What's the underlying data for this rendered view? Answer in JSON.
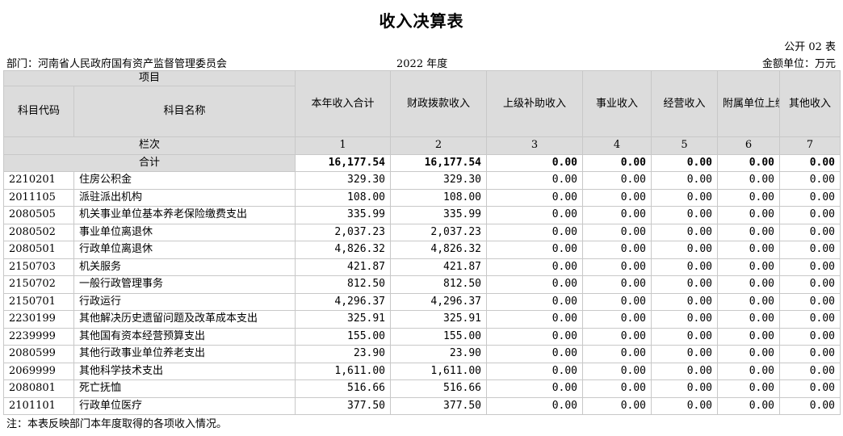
{
  "title": "收入决算表",
  "code": "公开 02 表",
  "department": "部门：河南省人民政府国有资产监督管理委员会",
  "year": "2022 年度",
  "unit": "金额单位：万元",
  "headers": {
    "item_group": "项目",
    "subject_code": "科目代码",
    "subject_name": "科目名称",
    "total_income": "本年收入合计",
    "fiscal_appropriation": "财政拨款收入",
    "superior_subsidy": "上级补助收入",
    "business_income": "事业收入",
    "operating_income": "经营收入",
    "affiliated_income": "附属单位上缴收入",
    "other_income": "其他收入",
    "column_index_label": "栏次",
    "column_numbers": [
      "1",
      "2",
      "3",
      "4",
      "5",
      "6",
      "7"
    ]
  },
  "total_row": {
    "label": "合计",
    "values": [
      "16,177.54",
      "16,177.54",
      "0.00",
      "0.00",
      "0.00",
      "0.00",
      "0.00"
    ]
  },
  "rows": [
    {
      "code": "2210201",
      "name": "住房公积金",
      "values": [
        "329.30",
        "329.30",
        "0.00",
        "0.00",
        "0.00",
        "0.00",
        "0.00"
      ]
    },
    {
      "code": "2011105",
      "name": "派驻派出机构",
      "values": [
        "108.00",
        "108.00",
        "0.00",
        "0.00",
        "0.00",
        "0.00",
        "0.00"
      ]
    },
    {
      "code": "2080505",
      "name": "机关事业单位基本养老保险缴费支出",
      "values": [
        "335.99",
        "335.99",
        "0.00",
        "0.00",
        "0.00",
        "0.00",
        "0.00"
      ]
    },
    {
      "code": "2080502",
      "name": "事业单位离退休",
      "values": [
        "2,037.23",
        "2,037.23",
        "0.00",
        "0.00",
        "0.00",
        "0.00",
        "0.00"
      ]
    },
    {
      "code": "2080501",
      "name": "行政单位离退休",
      "values": [
        "4,826.32",
        "4,826.32",
        "0.00",
        "0.00",
        "0.00",
        "0.00",
        "0.00"
      ]
    },
    {
      "code": "2150703",
      "name": "机关服务",
      "values": [
        "421.87",
        "421.87",
        "0.00",
        "0.00",
        "0.00",
        "0.00",
        "0.00"
      ]
    },
    {
      "code": "2150702",
      "name": "一般行政管理事务",
      "values": [
        "812.50",
        "812.50",
        "0.00",
        "0.00",
        "0.00",
        "0.00",
        "0.00"
      ]
    },
    {
      "code": "2150701",
      "name": "行政运行",
      "values": [
        "4,296.37",
        "4,296.37",
        "0.00",
        "0.00",
        "0.00",
        "0.00",
        "0.00"
      ]
    },
    {
      "code": "2230199",
      "name": "其他解决历史遗留问题及改革成本支出",
      "values": [
        "325.91",
        "325.91",
        "0.00",
        "0.00",
        "0.00",
        "0.00",
        "0.00"
      ]
    },
    {
      "code": "2239999",
      "name": "其他国有资本经营预算支出",
      "values": [
        "155.00",
        "155.00",
        "0.00",
        "0.00",
        "0.00",
        "0.00",
        "0.00"
      ]
    },
    {
      "code": "2080599",
      "name": "其他行政事业单位养老支出",
      "values": [
        "23.90",
        "23.90",
        "0.00",
        "0.00",
        "0.00",
        "0.00",
        "0.00"
      ]
    },
    {
      "code": "2069999",
      "name": "其他科学技术支出",
      "values": [
        "1,611.00",
        "1,611.00",
        "0.00",
        "0.00",
        "0.00",
        "0.00",
        "0.00"
      ]
    },
    {
      "code": "2080801",
      "name": "死亡抚恤",
      "values": [
        "516.66",
        "516.66",
        "0.00",
        "0.00",
        "0.00",
        "0.00",
        "0.00"
      ]
    },
    {
      "code": "2101101",
      "name": "行政单位医疗",
      "values": [
        "377.50",
        "377.50",
        "0.00",
        "0.00",
        "0.00",
        "0.00",
        "0.00"
      ]
    }
  ],
  "note": "注：本表反映部门本年度取得的各项收入情况。"
}
